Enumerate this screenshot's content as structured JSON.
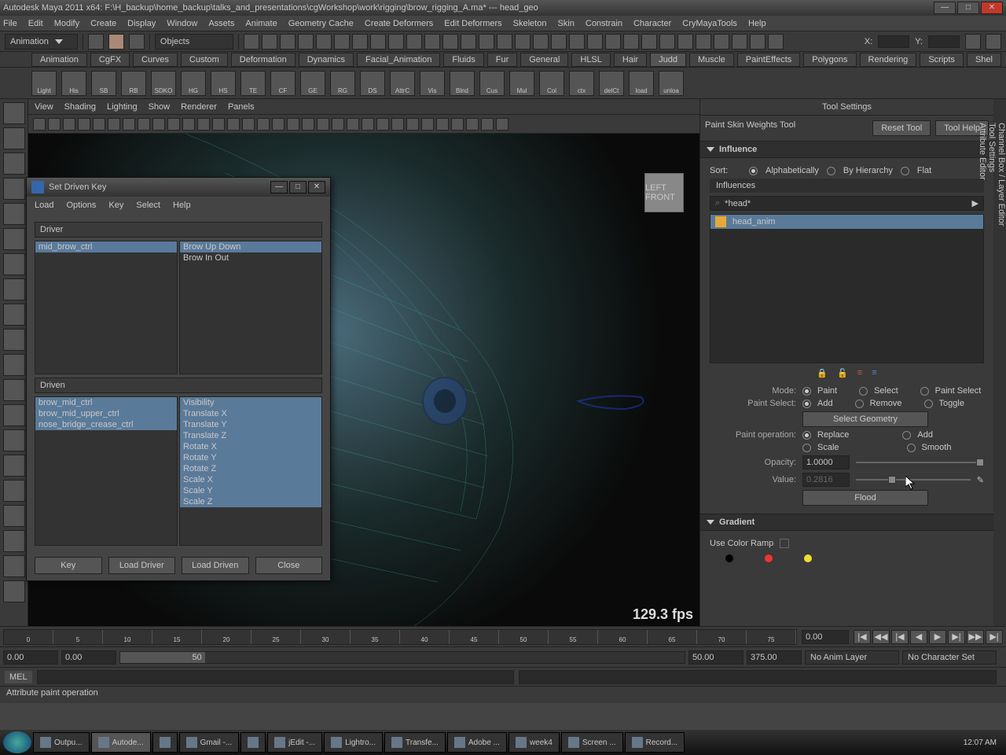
{
  "window": {
    "title": "Autodesk Maya 2011 x64: F:\\H_backup\\home_backup\\talks_and_presentations\\cgWorkshop\\work\\rigging\\brow_rigging_A.ma*  ---  head_geo"
  },
  "menu": [
    "File",
    "Edit",
    "Modify",
    "Create",
    "Display",
    "Window",
    "Assets",
    "Animate",
    "Geometry Cache",
    "Create Deformers",
    "Edit Deformers",
    "Skeleton",
    "Skin",
    "Constrain",
    "Character",
    "CryMayaTools",
    "Help"
  ],
  "module_dd": "Animation",
  "objects_dd": "Objects",
  "coord_labels": {
    "x": "X:",
    "y": "Y:"
  },
  "shelf_tabs": [
    "Animation",
    "CgFX",
    "Curves",
    "Custom",
    "Deformation",
    "Dynamics",
    "Facial_Animation",
    "Fluids",
    "Fur",
    "General",
    "HLSL",
    "Hair",
    "Judd",
    "Muscle",
    "PaintEffects",
    "Polygons",
    "Rendering",
    "Scripts",
    "Shel"
  ],
  "shelf_active": "Judd",
  "shelf_icons": [
    "Light",
    "His",
    "SB",
    "RB",
    "SDKO",
    "HG",
    "HS",
    "TE",
    "CF",
    "GE",
    "RG",
    "DS",
    "AttrC",
    "Vis",
    "Blnd",
    "Cus",
    "Mul",
    "Col",
    "ctx",
    "delCt",
    "load",
    "unloa"
  ],
  "viewport": {
    "menu": [
      "View",
      "Shading",
      "Lighting",
      "Show",
      "Renderer",
      "Panels"
    ],
    "fps": "129.3 fps",
    "cube_faces": "LEFT  FRONT"
  },
  "dialog": {
    "title": "Set Driven Key",
    "menu": [
      "Load",
      "Options",
      "Key",
      "Select",
      "Help"
    ],
    "driver_label": "Driver",
    "driven_label": "Driven",
    "driver_left": [
      "mid_brow_ctrl"
    ],
    "driver_right": [
      "Brow Up Down",
      "Brow In Out"
    ],
    "driver_right_sel": [
      0
    ],
    "driven_left": [
      "brow_mid_ctrl",
      "brow_mid_upper_ctrl",
      "nose_bridge_crease_ctrl"
    ],
    "driven_right": [
      "Visibility",
      "Translate X",
      "Translate Y",
      "Translate Z",
      "Rotate X",
      "Rotate Y",
      "Rotate Z",
      "Scale X",
      "Scale Y",
      "Scale Z"
    ],
    "buttons": [
      "Key",
      "Load Driver",
      "Load Driven",
      "Close"
    ]
  },
  "tool_settings": {
    "title": "Tool Settings",
    "tool_name": "Paint Skin Weights Tool",
    "btn_reset": "Reset Tool",
    "btn_help": "Tool Help",
    "sec_influence": "Influence",
    "sort_label": "Sort:",
    "sort_opts": [
      "Alphabetically",
      "By Hierarchy",
      "Flat"
    ],
    "influences_hdr": "Influences",
    "filter": "*head*",
    "inf_items": [
      "head_anim"
    ],
    "mode_label": "Mode:",
    "mode_opts": [
      "Paint",
      "Select",
      "Paint Select"
    ],
    "paintsel_label": "Paint Select:",
    "paintsel_opts": [
      "Add",
      "Remove",
      "Toggle"
    ],
    "selgeo": "Select Geometry",
    "paintop_label": "Paint operation:",
    "paintop_opts": [
      "Replace",
      "Add",
      "Scale",
      "Smooth"
    ],
    "opacity_label": "Opacity:",
    "opacity_val": "1.0000",
    "value_label": "Value:",
    "value_val": "0.2816",
    "flood": "Flood",
    "sec_gradient": "Gradient",
    "use_ramp": "Use Color Ramp"
  },
  "timeline": {
    "start": "0.00",
    "cur": "0.00",
    "end50": "50",
    "range_end": "50.00",
    "range_max": "375.00",
    "cur_frame": "0.00",
    "ticks": [
      0,
      5,
      10,
      15,
      20,
      25,
      30,
      35,
      40,
      45,
      50,
      55,
      60,
      65,
      70,
      75
    ],
    "anim_layer": "No Anim Layer",
    "char_set": "No Character Set"
  },
  "cmd": {
    "lang": "MEL"
  },
  "status": "Attribute paint operation",
  "taskbar": {
    "items": [
      "Outpu...",
      "Autode...",
      "",
      "Gmail -...",
      "",
      "jEdit -...",
      "Lightro...",
      "Transfe...",
      "Adobe ...",
      "week4",
      "Screen ...",
      "Record..."
    ],
    "active": 1,
    "clock": "12:07 AM"
  },
  "right_tabs": [
    "Channel Box / Layer Editor",
    "Tool Settings",
    "Attribute Editor"
  ]
}
